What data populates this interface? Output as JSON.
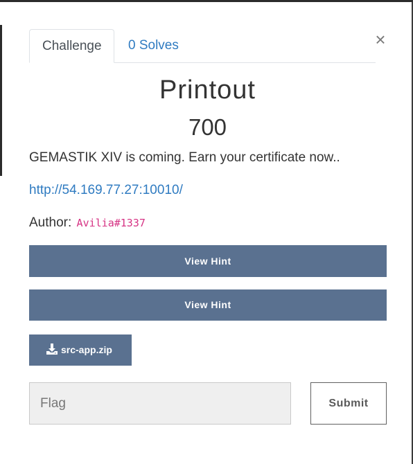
{
  "tabs": [
    {
      "label": "Challenge"
    },
    {
      "label": "0 Solves"
    }
  ],
  "close_symbol": "×",
  "challenge": {
    "title": "Printout",
    "value": "700",
    "description": "GEMASTIK XIV is coming. Earn your certificate now..",
    "link": "http://54.169.77.27:10010/",
    "author_label": "Author:",
    "author_handle": "Avilia#1337"
  },
  "hints": [
    {
      "label": "View Hint"
    },
    {
      "label": "View Hint"
    }
  ],
  "file": {
    "label": "src-app.zip",
    "icon": "download-icon"
  },
  "flag_form": {
    "placeholder": "Flag",
    "value": "",
    "submit_label": "Submit"
  },
  "colors": {
    "button_bg": "#5a7190",
    "link": "#2f7bc1",
    "author_handle": "#d63384"
  }
}
